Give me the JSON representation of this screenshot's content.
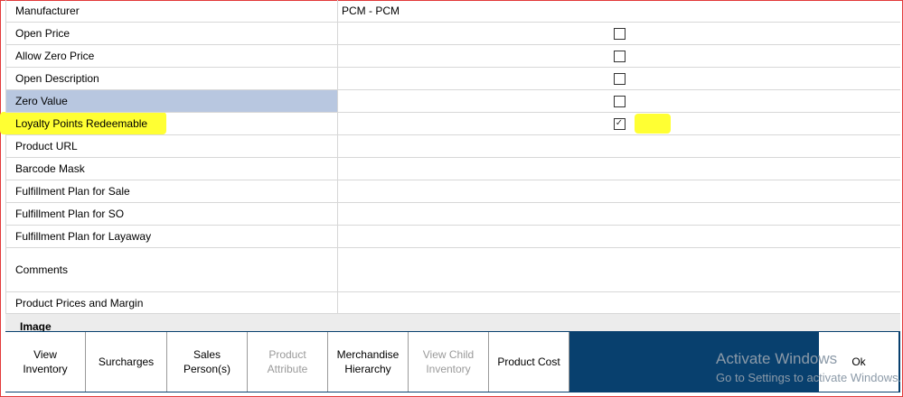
{
  "properties": [
    {
      "label": "Manufacturer",
      "value": "PCM - PCM"
    },
    {
      "label": "Open Price"
    },
    {
      "label": "Allow Zero Price"
    },
    {
      "label": "Open Description"
    },
    {
      "label": "Zero Value"
    },
    {
      "label": "Loyalty Points Redeemable",
      "checked": "✓"
    },
    {
      "label": "Product URL"
    },
    {
      "label": "Barcode Mask"
    },
    {
      "label": "Fulfillment Plan for Sale"
    },
    {
      "label": "Fulfillment Plan for SO"
    },
    {
      "label": "Fulfillment Plan for Layaway"
    },
    {
      "label": "Comments"
    },
    {
      "label": "Product Prices and Margin"
    }
  ],
  "image_section": {
    "label": "Image"
  },
  "toolbar": {
    "view_inventory": "View\nInventory",
    "surcharges": "Surcharges",
    "sales_persons": "Sales\nPerson(s)",
    "product_attribute": "Product\nAttribute",
    "merchandise_hierarchy": "Merchandise\nHierarchy",
    "view_child_inventory": "View Child\nInventory",
    "product_cost": "Product Cost",
    "ok": "Ok"
  },
  "watermark": {
    "line1": "Activate Windows",
    "line2": "Go to Settings to activate Windows."
  },
  "colors": {
    "toolbar_bg": "#08406e",
    "highlight": "#ffff33",
    "selected_row": "#b8c7e0",
    "frame_border": "#e23a3a"
  }
}
